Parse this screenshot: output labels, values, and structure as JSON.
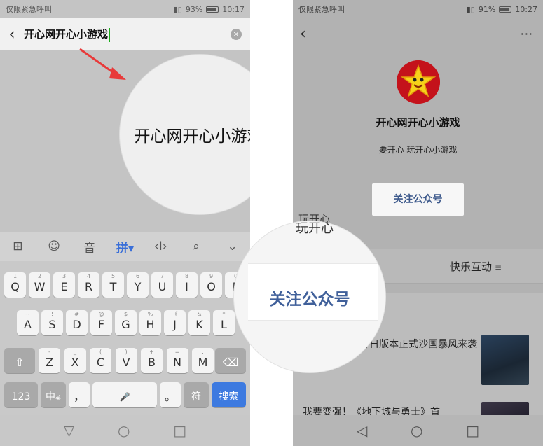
{
  "left_phone": {
    "status": {
      "left": "仅限紧急呼叫",
      "battery": "93%",
      "time": "10:17"
    },
    "search": {
      "back": "‹",
      "query": "开心网开心小游戏",
      "clear": "×"
    },
    "magnified_query": "开心网开心小游戏",
    "keyboard_toolbar": [
      "⊞",
      "☺",
      "音",
      "拼▾",
      "‹I›",
      "⌕",
      "⌄"
    ],
    "keyboard": {
      "row1": [
        {
          "main": "Q",
          "sub": "1"
        },
        {
          "main": "W",
          "sub": "2"
        },
        {
          "main": "E",
          "sub": "3"
        },
        {
          "main": "R",
          "sub": "4"
        },
        {
          "main": "T",
          "sub": "5"
        },
        {
          "main": "Y",
          "sub": "6"
        },
        {
          "main": "U",
          "sub": "7"
        },
        {
          "main": "I",
          "sub": "8"
        },
        {
          "main": "O",
          "sub": "9"
        },
        {
          "main": "P",
          "sub": "0"
        }
      ],
      "row2": [
        {
          "main": "A",
          "sub": "~"
        },
        {
          "main": "S",
          "sub": "!"
        },
        {
          "main": "D",
          "sub": "#"
        },
        {
          "main": "F",
          "sub": "@"
        },
        {
          "main": "G",
          "sub": "$"
        },
        {
          "main": "H",
          "sub": "%"
        },
        {
          "main": "J",
          "sub": "《"
        },
        {
          "main": "K",
          "sub": "&"
        },
        {
          "main": "L",
          "sub": "*"
        }
      ],
      "row3": [
        {
          "main": "Z",
          "sub": "-"
        },
        {
          "main": "X",
          "sub": "_"
        },
        {
          "main": "C",
          "sub": "("
        },
        {
          "main": "V",
          "sub": ")"
        },
        {
          "main": "B",
          "sub": "+"
        },
        {
          "main": "N",
          "sub": "="
        },
        {
          "main": "M",
          "sub": ":"
        }
      ],
      "shift": "⇧",
      "delete": "⌫",
      "num": "123",
      "lang": "中",
      "lang_sub": "英",
      "comma": "，",
      "mic": "🎤",
      "period": "。",
      "sym": "符",
      "search": "搜索"
    },
    "nav": [
      "▽",
      "○",
      "□"
    ]
  },
  "right_phone": {
    "status": {
      "left": "仅限紧急呼叫",
      "battery": "91%",
      "time": "10:27"
    },
    "topbar": {
      "back": "‹",
      "more": "···"
    },
    "account_name": "开心网开心小游戏",
    "account_desc": "要开心 玩开心小游戏",
    "follow_button": "关注公众号",
    "partial_text": "玩开心",
    "menu_item": "快乐互动",
    "menu_lines": "≡",
    "article1": "/ 春日版本正式沙国暴风来袭",
    "article2": "我要变强！《地下城与勇士》首",
    "nav": [
      "◁",
      "○",
      "□"
    ]
  },
  "magnifier_follow_text": "关注公众号",
  "magnifier_partial": "玩开心",
  "colors": {
    "wechat_green": "#1aad19",
    "arrow_red": "#e83a3a",
    "follow_blue": "#40609a",
    "key_blue": "#3d7ae0"
  }
}
